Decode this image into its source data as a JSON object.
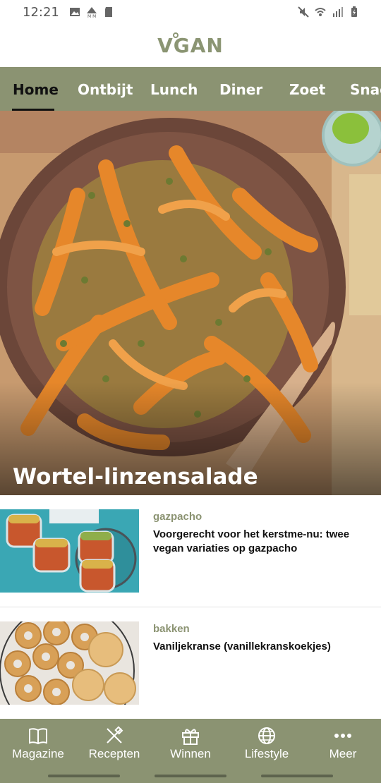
{
  "status_bar": {
    "time": "12:21",
    "left_icons": [
      "image-icon",
      "mm-icon",
      "sd-card-icon"
    ],
    "right_icons": [
      "mute-icon",
      "wifi-icon",
      "signal-icon",
      "battery-icon"
    ]
  },
  "app": {
    "logo_text": "VGAN",
    "accent_color": "#8b9372"
  },
  "tabs": [
    {
      "label": "Home",
      "active": true
    },
    {
      "label": "Ontbijt",
      "active": false
    },
    {
      "label": "Lunch",
      "active": false
    },
    {
      "label": "Diner",
      "active": false
    },
    {
      "label": "Zoet",
      "active": false
    },
    {
      "label": "Snac",
      "active": false
    }
  ],
  "hero": {
    "title": "Wortel-linzensalade"
  },
  "articles": [
    {
      "category": "gazpacho",
      "title": "Voorgerecht voor het kerstme-nu: twee vegan variaties op gazpacho"
    },
    {
      "category": "bakken",
      "title": "Vaniljekranse (vanillekranskoekjes)"
    }
  ],
  "bottom_nav": [
    {
      "label": "Magazine",
      "icon": "book-icon"
    },
    {
      "label": "Recepten",
      "icon": "utensils-icon"
    },
    {
      "label": "Winnen",
      "icon": "gift-icon"
    },
    {
      "label": "Lifestyle",
      "icon": "globe-icon"
    },
    {
      "label": "Meer",
      "icon": "more-icon"
    }
  ]
}
